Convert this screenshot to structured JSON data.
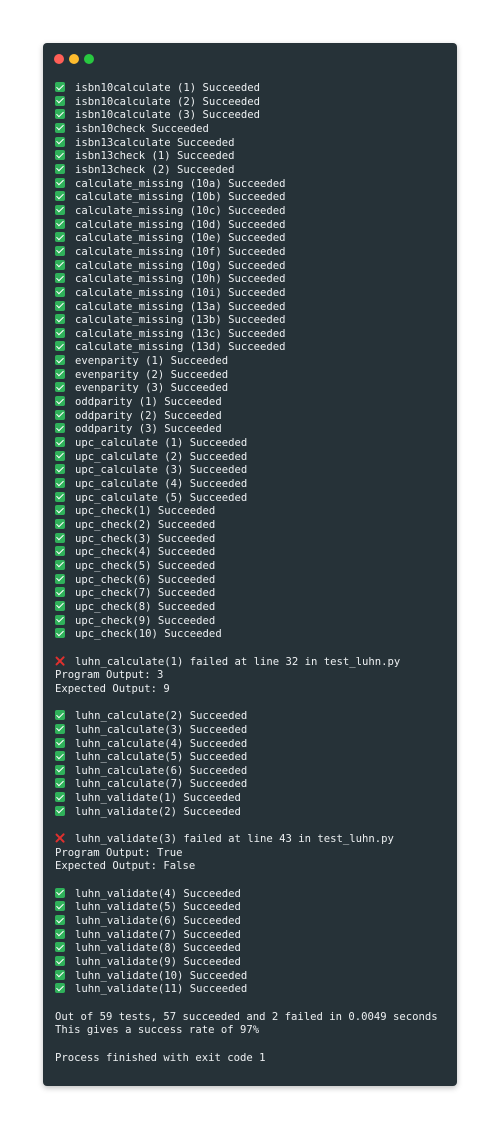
{
  "window": {
    "controls": [
      "close",
      "minimize",
      "maximize"
    ],
    "colors": {
      "background": "#263238",
      "text": "#eceff1",
      "success": "#2fb15a",
      "failure": "#e0302e"
    }
  },
  "console": {
    "lines": [
      {
        "kind": "success",
        "icon": "check-mark-icon",
        "text": "isbn10calculate (1) Succeeded"
      },
      {
        "kind": "success",
        "icon": "check-mark-icon",
        "text": "isbn10calculate (2) Succeeded"
      },
      {
        "kind": "success",
        "icon": "check-mark-icon",
        "text": "isbn10calculate (3) Succeeded"
      },
      {
        "kind": "success",
        "icon": "check-mark-icon",
        "text": "isbn10check Succeeded"
      },
      {
        "kind": "success",
        "icon": "check-mark-icon",
        "text": "isbn13calculate Succeeded"
      },
      {
        "kind": "success",
        "icon": "check-mark-icon",
        "text": "isbn13check (1) Succeeded"
      },
      {
        "kind": "success",
        "icon": "check-mark-icon",
        "text": "isbn13check (2) Succeeded"
      },
      {
        "kind": "success",
        "icon": "check-mark-icon",
        "text": "calculate_missing (10a) Succeeded"
      },
      {
        "kind": "success",
        "icon": "check-mark-icon",
        "text": "calculate_missing (10b) Succeeded"
      },
      {
        "kind": "success",
        "icon": "check-mark-icon",
        "text": "calculate_missing (10c) Succeeded"
      },
      {
        "kind": "success",
        "icon": "check-mark-icon",
        "text": "calculate_missing (10d) Succeeded"
      },
      {
        "kind": "success",
        "icon": "check-mark-icon",
        "text": "calculate_missing (10e) Succeeded"
      },
      {
        "kind": "success",
        "icon": "check-mark-icon",
        "text": "calculate_missing (10f) Succeeded"
      },
      {
        "kind": "success",
        "icon": "check-mark-icon",
        "text": "calculate_missing (10g) Succeeded"
      },
      {
        "kind": "success",
        "icon": "check-mark-icon",
        "text": "calculate_missing (10h) Succeeded"
      },
      {
        "kind": "success",
        "icon": "check-mark-icon",
        "text": "calculate_missing (10i) Succeeded"
      },
      {
        "kind": "success",
        "icon": "check-mark-icon",
        "text": "calculate_missing (13a) Succeeded"
      },
      {
        "kind": "success",
        "icon": "check-mark-icon",
        "text": "calculate_missing (13b) Succeeded"
      },
      {
        "kind": "success",
        "icon": "check-mark-icon",
        "text": "calculate_missing (13c) Succeeded"
      },
      {
        "kind": "success",
        "icon": "check-mark-icon",
        "text": "calculate_missing (13d) Succeeded"
      },
      {
        "kind": "success",
        "icon": "check-mark-icon",
        "text": "evenparity (1) Succeeded"
      },
      {
        "kind": "success",
        "icon": "check-mark-icon",
        "text": "evenparity (2) Succeeded"
      },
      {
        "kind": "success",
        "icon": "check-mark-icon",
        "text": "evenparity (3) Succeeded"
      },
      {
        "kind": "success",
        "icon": "check-mark-icon",
        "text": "oddparity (1) Succeeded"
      },
      {
        "kind": "success",
        "icon": "check-mark-icon",
        "text": "oddparity (2) Succeeded"
      },
      {
        "kind": "success",
        "icon": "check-mark-icon",
        "text": "oddparity (3) Succeeded"
      },
      {
        "kind": "success",
        "icon": "check-mark-icon",
        "text": "upc_calculate (1) Succeeded"
      },
      {
        "kind": "success",
        "icon": "check-mark-icon",
        "text": "upc_calculate (2) Succeeded"
      },
      {
        "kind": "success",
        "icon": "check-mark-icon",
        "text": "upc_calculate (3) Succeeded"
      },
      {
        "kind": "success",
        "icon": "check-mark-icon",
        "text": "upc_calculate (4) Succeeded"
      },
      {
        "kind": "success",
        "icon": "check-mark-icon",
        "text": "upc_calculate (5) Succeeded"
      },
      {
        "kind": "success",
        "icon": "check-mark-icon",
        "text": "upc_check(1) Succeeded"
      },
      {
        "kind": "success",
        "icon": "check-mark-icon",
        "text": "upc_check(2) Succeeded"
      },
      {
        "kind": "success",
        "icon": "check-mark-icon",
        "text": "upc_check(3) Succeeded"
      },
      {
        "kind": "success",
        "icon": "check-mark-icon",
        "text": "upc_check(4) Succeeded"
      },
      {
        "kind": "success",
        "icon": "check-mark-icon",
        "text": "upc_check(5) Succeeded"
      },
      {
        "kind": "success",
        "icon": "check-mark-icon",
        "text": "upc_check(6) Succeeded"
      },
      {
        "kind": "success",
        "icon": "check-mark-icon",
        "text": "upc_check(7) Succeeded"
      },
      {
        "kind": "success",
        "icon": "check-mark-icon",
        "text": "upc_check(8) Succeeded"
      },
      {
        "kind": "success",
        "icon": "check-mark-icon",
        "text": "upc_check(9) Succeeded"
      },
      {
        "kind": "success",
        "icon": "check-mark-icon",
        "text": "upc_check(10) Succeeded"
      },
      {
        "kind": "blank"
      },
      {
        "kind": "failure",
        "icon": "cross-mark-icon",
        "text": "luhn_calculate(1) failed at line 32 in test_luhn.py"
      },
      {
        "kind": "plain",
        "text": "Program Output: 3"
      },
      {
        "kind": "plain",
        "text": "Expected Output: 9"
      },
      {
        "kind": "blank"
      },
      {
        "kind": "success",
        "icon": "check-mark-icon",
        "text": "luhn_calculate(2) Succeeded"
      },
      {
        "kind": "success",
        "icon": "check-mark-icon",
        "text": "luhn_calculate(3) Succeeded"
      },
      {
        "kind": "success",
        "icon": "check-mark-icon",
        "text": "luhn_calculate(4) Succeeded"
      },
      {
        "kind": "success",
        "icon": "check-mark-icon",
        "text": "luhn_calculate(5) Succeeded"
      },
      {
        "kind": "success",
        "icon": "check-mark-icon",
        "text": "luhn_calculate(6) Succeeded"
      },
      {
        "kind": "success",
        "icon": "check-mark-icon",
        "text": "luhn_calculate(7) Succeeded"
      },
      {
        "kind": "success",
        "icon": "check-mark-icon",
        "text": "luhn_validate(1) Succeeded"
      },
      {
        "kind": "success",
        "icon": "check-mark-icon",
        "text": "luhn_validate(2) Succeeded"
      },
      {
        "kind": "blank"
      },
      {
        "kind": "failure",
        "icon": "cross-mark-icon",
        "text": "luhn_validate(3) failed at line 43 in test_luhn.py"
      },
      {
        "kind": "plain",
        "text": "Program Output: True"
      },
      {
        "kind": "plain",
        "text": "Expected Output: False"
      },
      {
        "kind": "blank"
      },
      {
        "kind": "success",
        "icon": "check-mark-icon",
        "text": "luhn_validate(4) Succeeded"
      },
      {
        "kind": "success",
        "icon": "check-mark-icon",
        "text": "luhn_validate(5) Succeeded"
      },
      {
        "kind": "success",
        "icon": "check-mark-icon",
        "text": "luhn_validate(6) Succeeded"
      },
      {
        "kind": "success",
        "icon": "check-mark-icon",
        "text": "luhn_validate(7) Succeeded"
      },
      {
        "kind": "success",
        "icon": "check-mark-icon",
        "text": "luhn_validate(8) Succeeded"
      },
      {
        "kind": "success",
        "icon": "check-mark-icon",
        "text": "luhn_validate(9) Succeeded"
      },
      {
        "kind": "success",
        "icon": "check-mark-icon",
        "text": "luhn_validate(10) Succeeded"
      },
      {
        "kind": "success",
        "icon": "check-mark-icon",
        "text": "luhn_validate(11) Succeeded"
      },
      {
        "kind": "blank"
      },
      {
        "kind": "plain",
        "text": "Out of 59 tests, 57 succeeded and 2 failed in 0.0049 seconds"
      },
      {
        "kind": "plain",
        "text": "This gives a success rate of 97%"
      },
      {
        "kind": "blank"
      },
      {
        "kind": "plain",
        "text": "Process finished with exit code 1"
      }
    ]
  }
}
